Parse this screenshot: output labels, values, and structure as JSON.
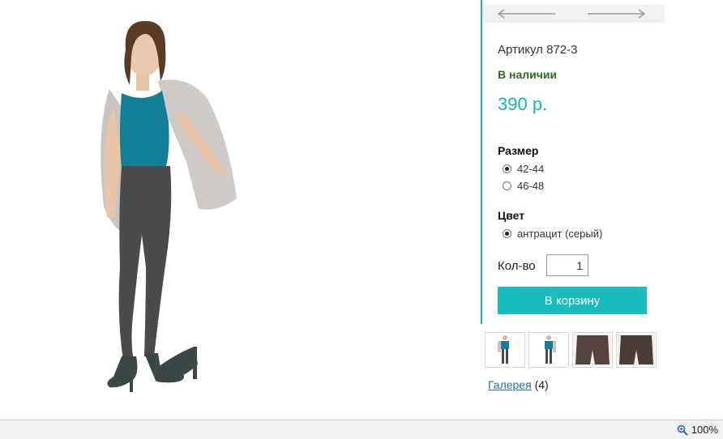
{
  "product": {
    "sku_label": "Артикул 872-3",
    "stock_status": "В наличии",
    "price": "390 р."
  },
  "options": {
    "size": {
      "title": "Размер",
      "items": [
        {
          "label": "42-44",
          "selected": true
        },
        {
          "label": "46-48",
          "selected": false
        }
      ]
    },
    "color": {
      "title": "Цвет",
      "items": [
        {
          "label": "антрацит (серый)",
          "selected": true
        }
      ]
    }
  },
  "quantity": {
    "label": "Кол-во",
    "value": "1"
  },
  "cart": {
    "button_label": "В корзину"
  },
  "gallery": {
    "link_label": "Галерея",
    "count": "(4)",
    "thumbnails": [
      "thumb-woman-front",
      "thumb-woman-side",
      "thumb-leggings-back",
      "thumb-leggings-back-dark"
    ]
  },
  "statusbar": {
    "zoom": "100%",
    "zoom_icon": "magnifier-icon"
  },
  "colors": {
    "accent": "#19b4b4",
    "in_stock": "#2d6b1e",
    "link": "#2a6fa0"
  }
}
